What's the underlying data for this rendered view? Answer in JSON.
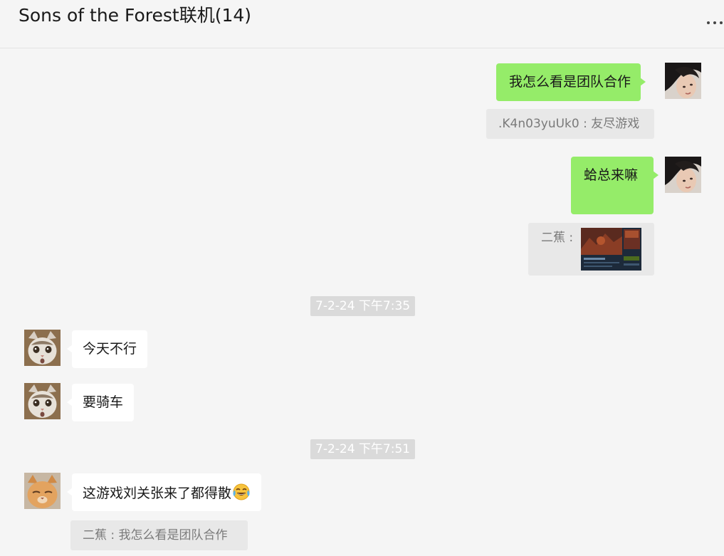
{
  "chat": {
    "title": "Sons of the Forest联机(14)"
  },
  "messages": {
    "m1": {
      "text": "我怎么看是团队合作",
      "quote": ".K4n03yuUk0 : 友尽游戏"
    },
    "m2": {
      "text": "蛤总来嘛",
      "quote_label": "二蕉 :"
    },
    "ts1": "7-2-24 下午7:35",
    "m3": {
      "text": "今天不行"
    },
    "m4": {
      "text": "要骑车"
    },
    "ts2": "7-2-24 下午7:51",
    "m5": {
      "text": "这游戏刘关张来了都得散",
      "emoji": "tears-of-joy-emoji",
      "quote": "二蕉 : 我怎么看是团队合作"
    }
  },
  "icons": {
    "more": "more-horizontal-icon",
    "self_avatar": "avatar-person-photo",
    "cat_avatar": "avatar-cat-photo",
    "quoted_image": "game-screenshot-thumbnail"
  },
  "colors": {
    "self_bubble": "#95ec69",
    "other_bubble": "#ffffff",
    "background": "#f5f5f5",
    "quote_bg": "#e8e8e8",
    "timestamp_bg": "#dadada"
  }
}
